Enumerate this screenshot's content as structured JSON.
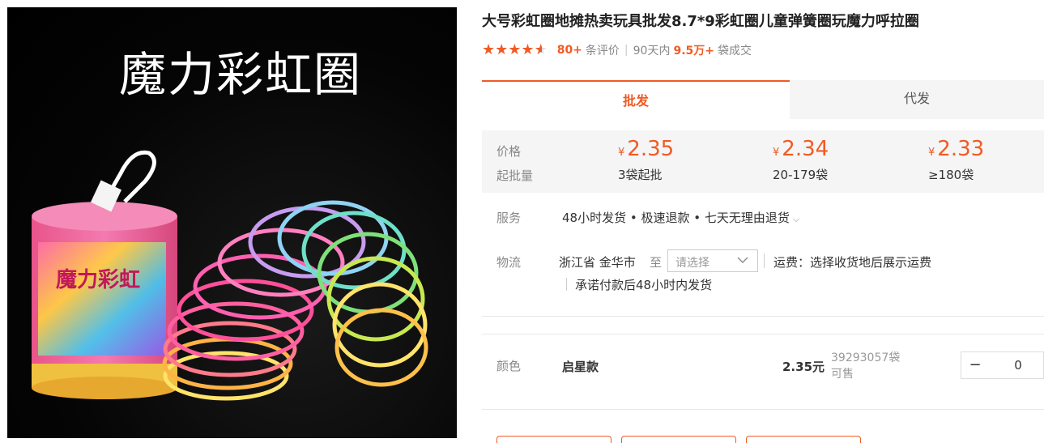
{
  "image": {
    "title": "魔力彩虹圈"
  },
  "product": {
    "title": "大号彩虹圈地摊热卖玩具批发8.7*9彩虹圈儿童弹簧圈玩魔力呼拉圈",
    "rating": 4.5,
    "review_count": "80+",
    "review_label": "条评价",
    "sales_prefix": "90天内",
    "sales_count": "9.5万+",
    "sales_suffix": "袋成交"
  },
  "tabs": [
    {
      "label": "批发",
      "active": true
    },
    {
      "label": "代发",
      "active": false
    }
  ],
  "pricing": {
    "price_label": "价格",
    "moq_label": "起批量",
    "currency": "¥",
    "tiers": [
      {
        "price": "2.35",
        "qty": "3袋起批"
      },
      {
        "price": "2.34",
        "qty": "20-179袋"
      },
      {
        "price": "2.33",
        "qty": "≥180袋"
      }
    ]
  },
  "service": {
    "label": "服务",
    "text": "48小时发货 • 极速退款 • 七天无理由退货"
  },
  "logistics": {
    "label": "物流",
    "origin": "浙江省 金华市",
    "to": "至",
    "select_placeholder": "请选择",
    "freight": "运费：选择收货地后展示运费",
    "promise": "承诺付款后48小时内发货"
  },
  "sku": {
    "label": "颜色",
    "name": "启星款",
    "price": "2.35元",
    "stock": "39293057袋可售",
    "minus": "−",
    "quantity": "0"
  },
  "colors": {
    "accent": "#f15a24",
    "price_bg": "#f5f5f5"
  }
}
